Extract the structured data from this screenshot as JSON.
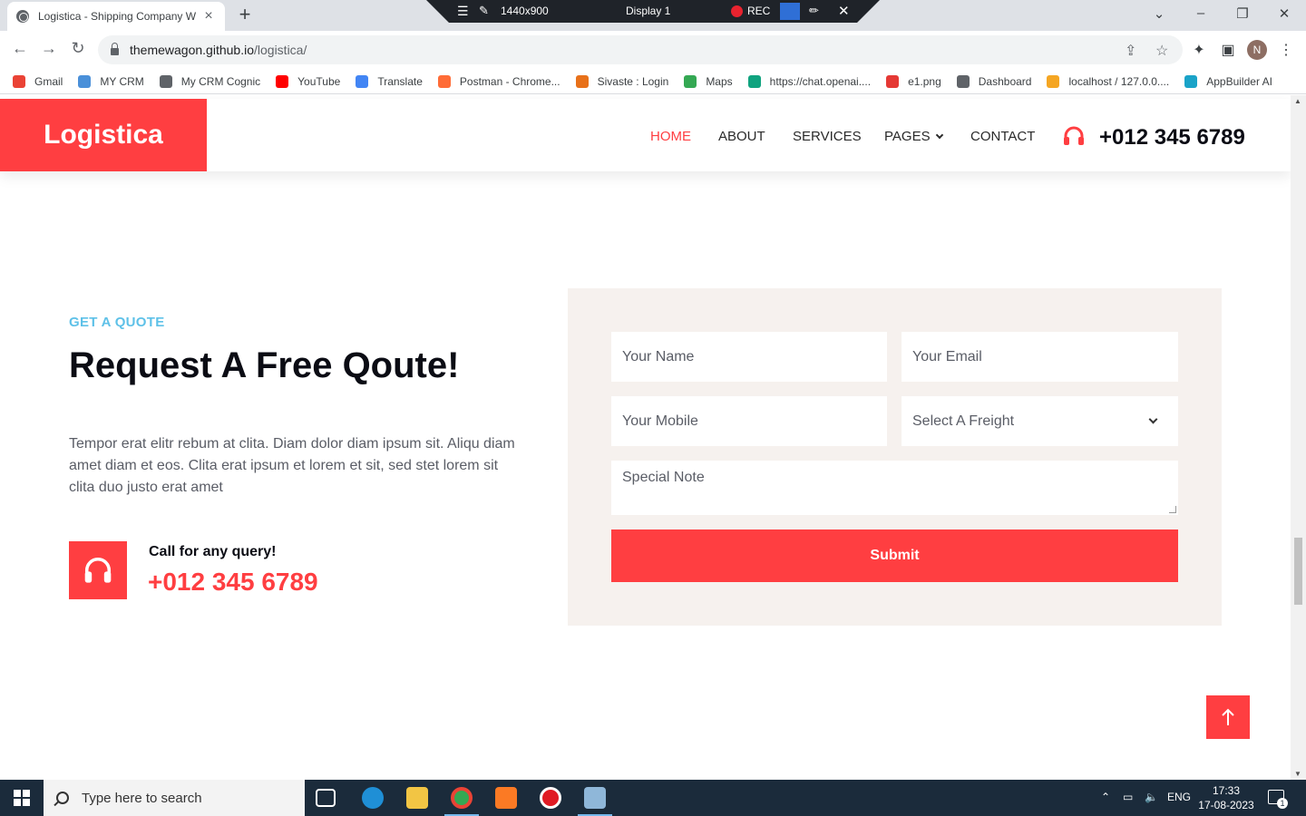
{
  "browser": {
    "tab_title": "Logistica - Shipping Company W",
    "tab_close": "×",
    "new_tab": "+",
    "url_host": "themewagon.github.io",
    "url_path": "/logistica/",
    "profile_initial": "N",
    "bookmarks": [
      {
        "label": "Gmail",
        "color": "#ea4335"
      },
      {
        "label": "MY CRM",
        "color": "#4a90d9"
      },
      {
        "label": "My CRM Cognic",
        "color": "#5f6368"
      },
      {
        "label": "YouTube",
        "color": "#ff0000"
      },
      {
        "label": "Translate",
        "color": "#4285f4"
      },
      {
        "label": "Postman - Chrome...",
        "color": "#ff6c37"
      },
      {
        "label": "Sivaste : Login",
        "color": "#e8711a"
      },
      {
        "label": "Maps",
        "color": "#34a853"
      },
      {
        "label": "https://chat.openai....",
        "color": "#10a37f"
      },
      {
        "label": "e1.png",
        "color": "#e53935"
      },
      {
        "label": "Dashboard",
        "color": "#5f6368"
      },
      {
        "label": "localhost / 127.0.0....",
        "color": "#f5a623"
      },
      {
        "label": "AppBuilder AI",
        "color": "#1aa3c8"
      }
    ]
  },
  "recorder": {
    "resolution": "1440x900",
    "display": "Display 1",
    "rec": "REC"
  },
  "site": {
    "brand": "Logistica",
    "nav": [
      {
        "label": "HOME",
        "active": true
      },
      {
        "label": "ABOUT",
        "active": false
      },
      {
        "label": "SERVICES",
        "active": false
      },
      {
        "label": "PAGES",
        "active": false
      },
      {
        "label": "CONTACT",
        "active": false
      }
    ],
    "nav_phone": "+012 345 6789",
    "accent": "#ff3e41",
    "eyebrow_color": "#5ec1e8"
  },
  "quote": {
    "eyebrow": "GET A QUOTE",
    "heading": "Request A Free Qoute!",
    "paragraph": "Tempor erat elitr rebum at clita. Diam dolor diam ipsum sit. Aliqu diam amet diam et eos. Clita erat ipsum et lorem et sit, sed stet lorem sit clita duo justo erat amet",
    "call_title": "Call for any query!",
    "call_phone": "+012 345 6789",
    "form": {
      "name_placeholder": "Your Name",
      "email_placeholder": "Your Email",
      "mobile_placeholder": "Your Mobile",
      "freight_selected": "Select A Freight",
      "note_placeholder": "Special Note",
      "submit_label": "Submit"
    }
  },
  "taskbar": {
    "search_placeholder": "Type here to search",
    "language": "ENG",
    "time": "17:33",
    "date": "17-08-2023",
    "notifications": "1"
  }
}
